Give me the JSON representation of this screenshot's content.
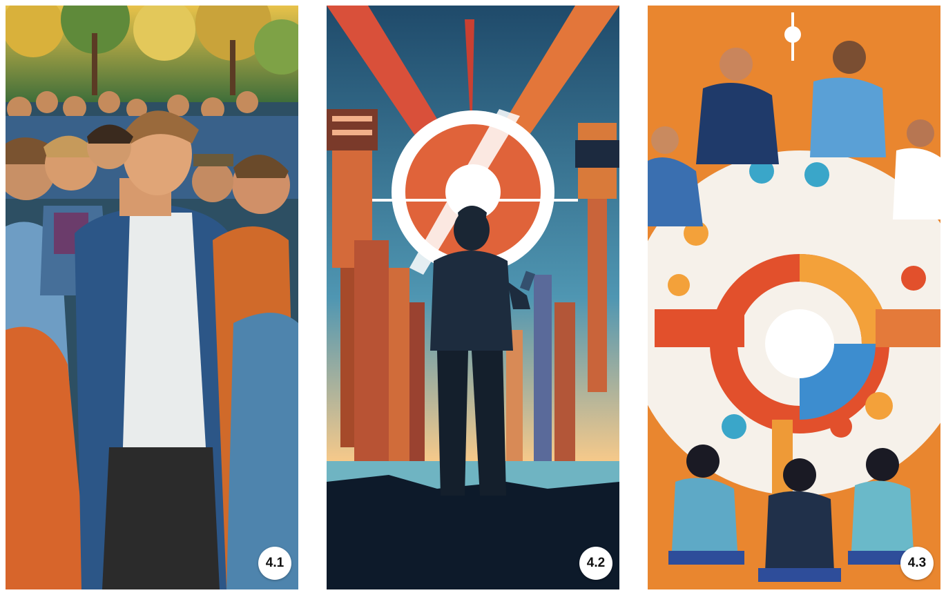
{
  "panels": [
    {
      "label": "4.1",
      "scene": "crowd-of-young-men-in-park"
    },
    {
      "label": "4.2",
      "scene": "man-with-phone-before-futuristic-city"
    },
    {
      "label": "4.3",
      "scene": "people-around-round-table-with-charts"
    }
  ],
  "colors": {
    "background": "#ffffff",
    "badge_bg": "#ffffff",
    "badge_text": "#111111"
  }
}
